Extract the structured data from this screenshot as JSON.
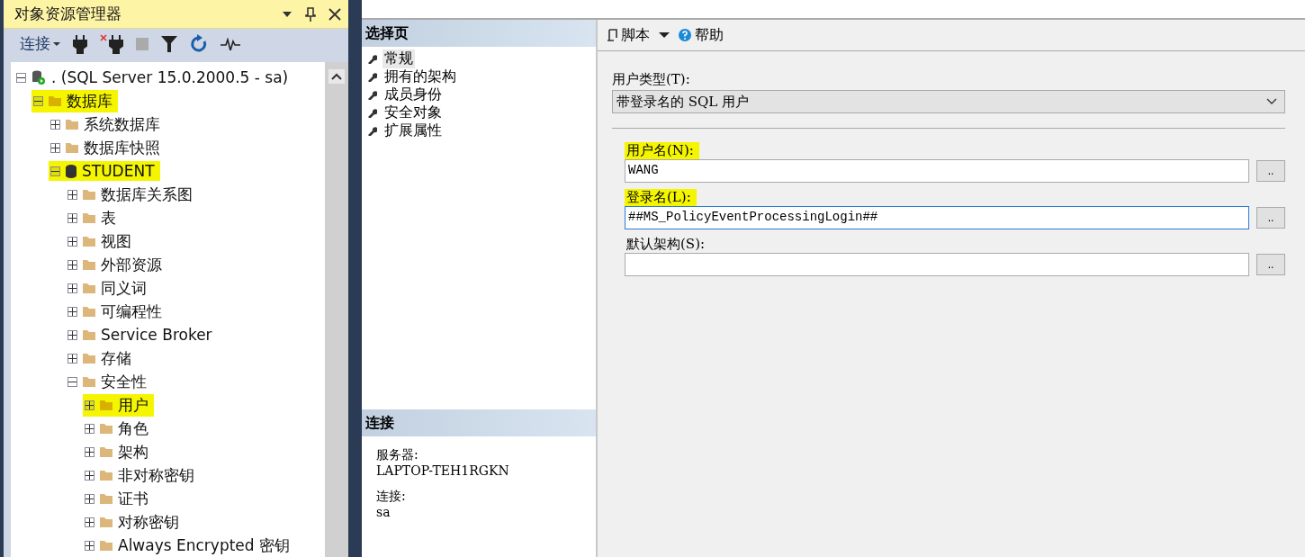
{
  "object_explorer": {
    "title": "对象资源管理器",
    "toolbar": {
      "connect": "连接"
    },
    "tree": [
      {
        "label": ". (SQL Server 15.0.2000.5 - sa)",
        "kind": "server",
        "expanded": true,
        "highlighted": false,
        "children": [
          {
            "label": "数据库",
            "kind": "folder",
            "expanded": true,
            "highlighted": true,
            "children": [
              {
                "label": "系统数据库",
                "kind": "folder",
                "expanded": false,
                "highlighted": false
              },
              {
                "label": "数据库快照",
                "kind": "folder",
                "expanded": false,
                "highlighted": false
              },
              {
                "label": "STUDENT",
                "kind": "database",
                "expanded": true,
                "highlighted": true,
                "children": [
                  {
                    "label": "数据库关系图",
                    "kind": "folder",
                    "expanded": false,
                    "highlighted": false
                  },
                  {
                    "label": "表",
                    "kind": "folder",
                    "expanded": false,
                    "highlighted": false
                  },
                  {
                    "label": "视图",
                    "kind": "folder",
                    "expanded": false,
                    "highlighted": false
                  },
                  {
                    "label": "外部资源",
                    "kind": "folder",
                    "expanded": false,
                    "highlighted": false
                  },
                  {
                    "label": "同义词",
                    "kind": "folder",
                    "expanded": false,
                    "highlighted": false
                  },
                  {
                    "label": "可编程性",
                    "kind": "folder",
                    "expanded": false,
                    "highlighted": false
                  },
                  {
                    "label": "Service Broker",
                    "kind": "folder",
                    "expanded": false,
                    "highlighted": false
                  },
                  {
                    "label": "存储",
                    "kind": "folder",
                    "expanded": false,
                    "highlighted": false
                  },
                  {
                    "label": "安全性",
                    "kind": "folder",
                    "expanded": true,
                    "highlighted": false,
                    "children": [
                      {
                        "label": "用户",
                        "kind": "folder",
                        "expanded": false,
                        "highlighted": true
                      },
                      {
                        "label": "角色",
                        "kind": "folder",
                        "expanded": false,
                        "highlighted": false
                      },
                      {
                        "label": "架构",
                        "kind": "folder",
                        "expanded": false,
                        "highlighted": false
                      },
                      {
                        "label": "非对称密钥",
                        "kind": "folder",
                        "expanded": false,
                        "highlighted": false
                      },
                      {
                        "label": "证书",
                        "kind": "folder",
                        "expanded": false,
                        "highlighted": false
                      },
                      {
                        "label": "对称密钥",
                        "kind": "folder",
                        "expanded": false,
                        "highlighted": false
                      },
                      {
                        "label": "Always Encrypted 密钥",
                        "kind": "folder",
                        "expanded": false,
                        "highlighted": false
                      }
                    ]
                  }
                ]
              }
            ]
          }
        ]
      }
    ]
  },
  "dialog": {
    "select_page": {
      "title": "选择页",
      "pages": [
        {
          "label": "常规",
          "selected": true
        },
        {
          "label": "拥有的架构",
          "selected": false
        },
        {
          "label": "成员身份",
          "selected": false
        },
        {
          "label": "安全对象",
          "selected": false
        },
        {
          "label": "扩展属性",
          "selected": false
        }
      ]
    },
    "connection": {
      "title": "连接",
      "server_label": "服务器:",
      "server": "LAPTOP-TEH1RGKN",
      "connection_label": "连接:",
      "connection": "sa"
    },
    "toolbar": {
      "script": "脚本",
      "help": "帮助"
    },
    "form": {
      "user_type_label": "用户类型(T):",
      "user_type": "带登录名的 SQL 用户",
      "fields": [
        {
          "label": "用户名(N):",
          "value": "WANG",
          "highlighted": true,
          "focused": false,
          "button": ".."
        },
        {
          "label": "登录名(L):",
          "value": "##MS_PolicyEventProcessingLogin##",
          "highlighted": true,
          "focused": true,
          "button": ".."
        },
        {
          "label": "默认架构(S):",
          "highlighted": false,
          "focused": false,
          "button": ".."
        }
      ]
    }
  }
}
